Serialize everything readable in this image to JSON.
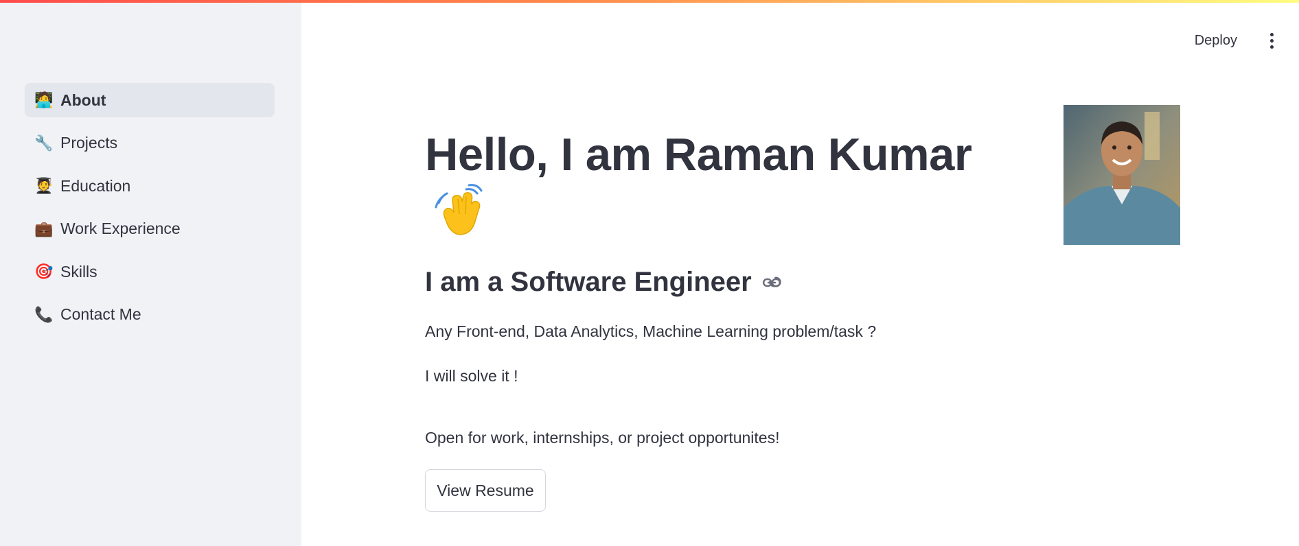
{
  "sidebar": {
    "items": [
      {
        "icon": "technologist-icon",
        "label": "About",
        "active": true
      },
      {
        "icon": "wrench-icon",
        "label": "Projects",
        "active": false
      },
      {
        "icon": "graduate-icon",
        "label": "Education",
        "active": false
      },
      {
        "icon": "briefcase-icon",
        "label": "Work Experience",
        "active": false
      },
      {
        "icon": "target-icon",
        "label": "Skills",
        "active": false
      },
      {
        "icon": "telephone-icon",
        "label": "Contact Me",
        "active": false
      }
    ]
  },
  "header": {
    "deploy_label": "Deploy",
    "menu_icon": "kebab-menu-icon"
  },
  "main": {
    "title": "Hello, I am Raman Kumar",
    "title_icon": "waving-hand-icon",
    "subheading": "I am a Software Engineer",
    "subheading_icon": "link-icon",
    "paragraphs": [
      "Any Front-end, Data Analytics, Machine Learning problem/task ?",
      "I will solve it !",
      "Open for work, internships, or project opportunites!"
    ],
    "resume_button": "View Resume",
    "photo": "profile-photo"
  },
  "colors": {
    "sidebar_bg": "#f0f2f6",
    "active_item_bg": "#e3e6ec",
    "text": "#31333f",
    "accent_gradient_start": "#ff4b4b",
    "accent_gradient_end": "#fffd80"
  }
}
